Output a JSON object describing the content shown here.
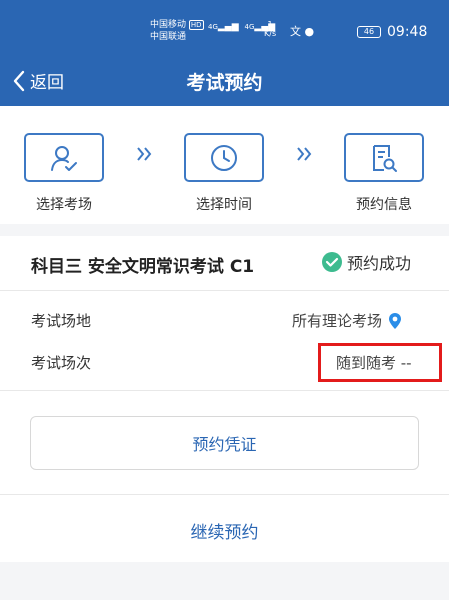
{
  "status_bar": {
    "carrier_1": "中国移动",
    "carrier_badge": "HD",
    "carrier_2": "中国联通",
    "network_1": "4G",
    "network_2": "4G",
    "speed_value": "1",
    "speed_unit": "K/s",
    "battery": "46",
    "time": "09:48"
  },
  "nav": {
    "back_label": "返回",
    "title": "考试预约"
  },
  "steps": [
    {
      "label": "选择考场",
      "icon": "user-check-icon"
    },
    {
      "label": "选择时间",
      "icon": "clock-icon"
    },
    {
      "label": "预约信息",
      "icon": "document-search-icon"
    }
  ],
  "card": {
    "subject": "科目三 安全文明常识考试 C1",
    "status": "预约成功",
    "venue_label": "考试场地",
    "venue_value": "所有理论考场",
    "session_label": "考试场次",
    "session_value": "随到随考 --",
    "voucher_button": "预约凭证",
    "continue_label": "继续预约"
  },
  "colors": {
    "primary": "#2a66b3",
    "success": "#3dbb8f",
    "highlight": "#e31b1b"
  }
}
